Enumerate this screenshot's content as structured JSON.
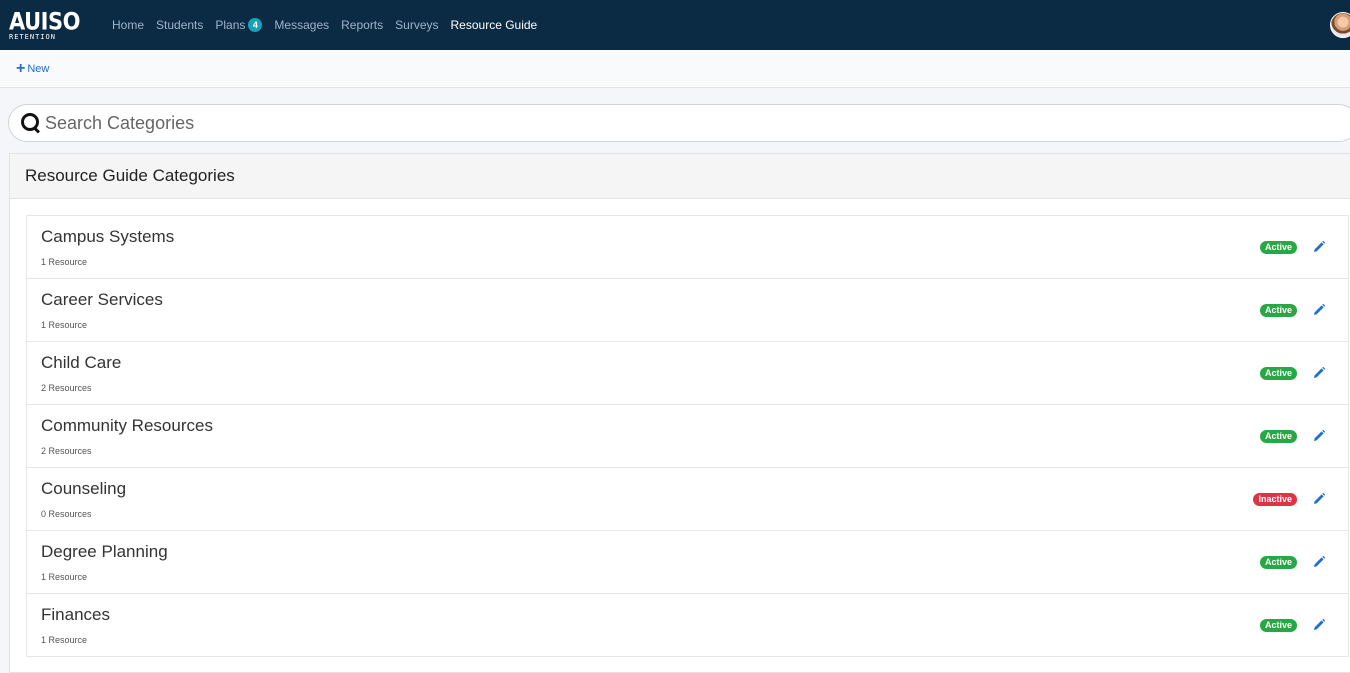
{
  "brand": {
    "name": "AUISO",
    "sub": "RETENTION"
  },
  "nav": {
    "items": [
      {
        "label": "Home"
      },
      {
        "label": "Students"
      },
      {
        "label": "Plans",
        "badge": "4"
      },
      {
        "label": "Messages"
      },
      {
        "label": "Reports"
      },
      {
        "label": "Surveys"
      },
      {
        "label": "Resource Guide",
        "active": true
      }
    ]
  },
  "toolbar": {
    "new_label": "New"
  },
  "search": {
    "placeholder": "Search Categories",
    "value": ""
  },
  "card": {
    "title": "Resource Guide Categories"
  },
  "categories": [
    {
      "name": "Campus Systems",
      "count": "1 Resource",
      "status": "Active"
    },
    {
      "name": "Career Services",
      "count": "1 Resource",
      "status": "Active"
    },
    {
      "name": "Child Care",
      "count": "2 Resources",
      "status": "Active"
    },
    {
      "name": "Community Resources",
      "count": "2 Resources",
      "status": "Active"
    },
    {
      "name": "Counseling",
      "count": "0 Resources",
      "status": "Inactive"
    },
    {
      "name": "Degree Planning",
      "count": "1 Resource",
      "status": "Active"
    },
    {
      "name": "Finances",
      "count": "1 Resource",
      "status": "Active"
    }
  ],
  "colors": {
    "navbar": "#0b2b45",
    "active": "#28a745",
    "inactive": "#dc3545",
    "link": "#1f6fd1"
  }
}
